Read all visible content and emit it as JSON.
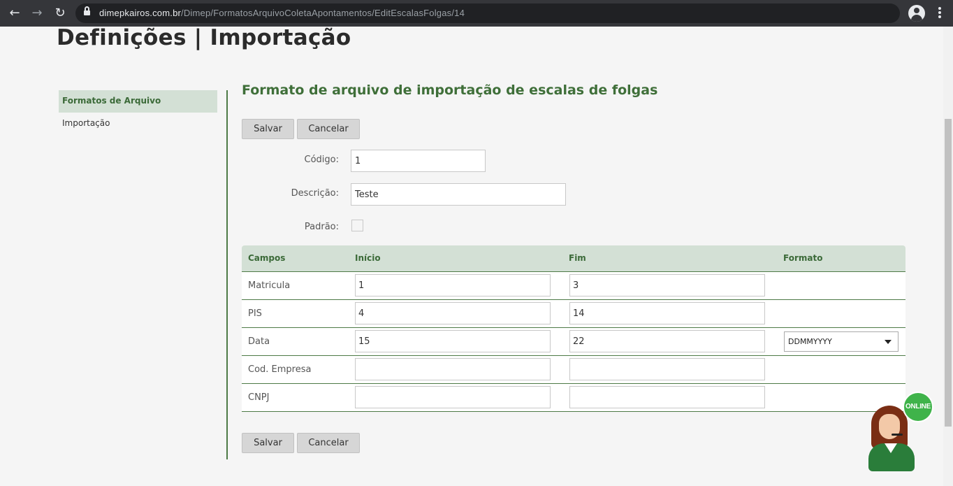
{
  "browser": {
    "url_host": "dimepkairos.com.br",
    "url_path": "/Dimep/FormatosArquivoColetaApontamentos/EditEscalasFolgas/14"
  },
  "page": {
    "title": "Definições | Importação"
  },
  "sidebar": {
    "items": [
      {
        "label": "Formatos de Arquivo",
        "active": true
      },
      {
        "label": "Importação",
        "active": false
      }
    ]
  },
  "form": {
    "heading": "Formato de arquivo de importação de escalas de folgas",
    "save_label": "Salvar",
    "cancel_label": "Cancelar",
    "codigo_label": "Código:",
    "codigo_value": "1",
    "descricao_label": "Descrição:",
    "descricao_value": "Teste",
    "padrao_label": "Padrão:",
    "padrao_checked": false
  },
  "grid": {
    "headers": {
      "campos": "Campos",
      "inicio": "Início",
      "fim": "Fim",
      "formato": "Formato"
    },
    "rows": [
      {
        "campo": "Matricula",
        "inicio": "1",
        "fim": "3",
        "formato": ""
      },
      {
        "campo": "PIS",
        "inicio": "4",
        "fim": "14",
        "formato": ""
      },
      {
        "campo": "Data",
        "inicio": "15",
        "fim": "22",
        "formato": "DDMMYYYY"
      },
      {
        "campo": "Cod. Empresa",
        "inicio": "",
        "fim": "",
        "formato": ""
      },
      {
        "campo": "CNPJ",
        "inicio": "",
        "fim": "",
        "formato": ""
      }
    ]
  },
  "support_widget": {
    "badge": "ONLINE"
  },
  "colors": {
    "accent_green": "#3f6f39",
    "header_bg": "#d3e0d5",
    "online_badge": "#3fb34a"
  },
  "icons": [
    "back-arrow-icon",
    "forward-arrow-icon",
    "reload-icon",
    "lock-icon",
    "star-icon",
    "account-icon",
    "menu-dots-icon",
    "dropdown-caret-icon"
  ]
}
